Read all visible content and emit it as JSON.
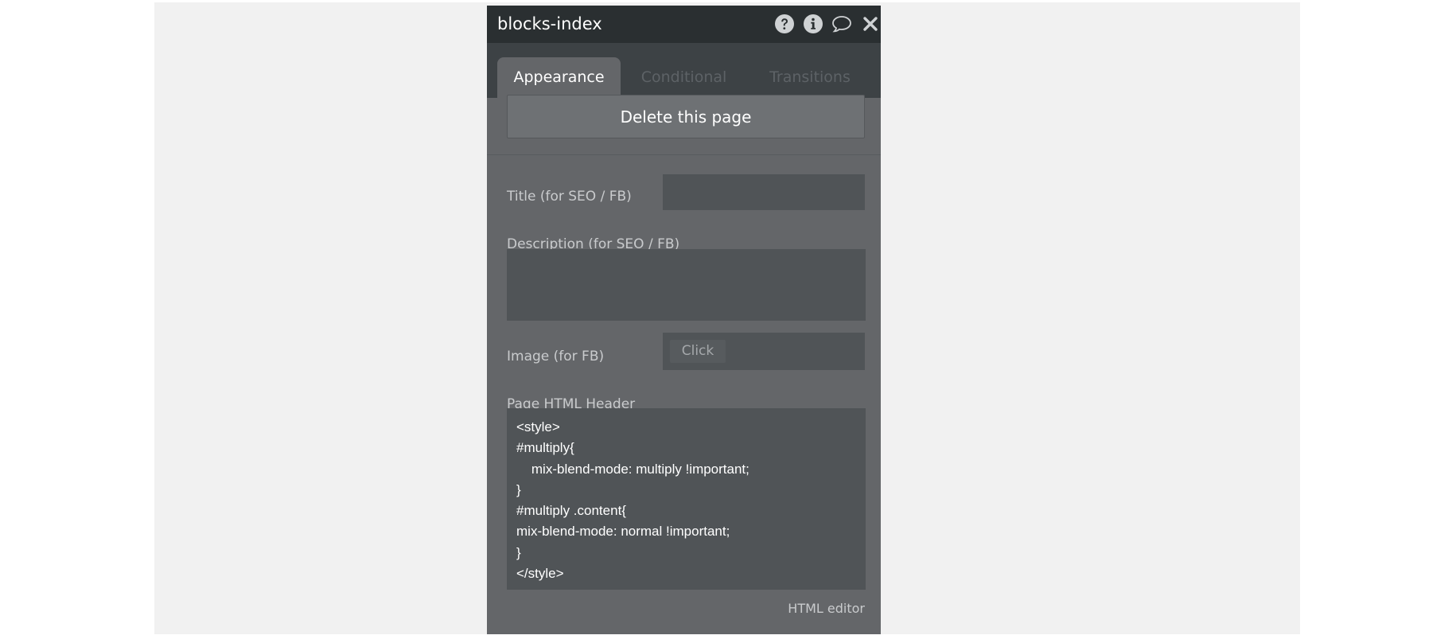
{
  "panel": {
    "title": "blocks-index"
  },
  "icons": {
    "help": "question-circle-icon",
    "info": "info-circle-icon",
    "comment": "comment-bubble-icon",
    "close": "close-icon"
  },
  "tabs": [
    {
      "label": "Appearance",
      "active": true
    },
    {
      "label": "Conditional",
      "active": false
    },
    {
      "label": "Transitions",
      "active": false
    }
  ],
  "actions": {
    "delete_label": "Delete this page"
  },
  "form": {
    "title_label": "Title (for SEO / FB)",
    "title_value": "",
    "description_label": "Description (for SEO / FB)",
    "description_value": "",
    "image_label": "Image (for FB)",
    "image_button": "Click",
    "header_label": "Page HTML Header",
    "header_code_lines": [
      "<style>",
      "#multiply{",
      "    mix-blend-mode: multiply !important;",
      "}",
      "#multiply .content{",
      "mix-blend-mode: normal !important;",
      "}",
      "</style>"
    ],
    "html_editor_link": "HTML editor"
  },
  "colors": {
    "titlebar": "#2a2f31",
    "tabbar": "#3d4245",
    "panel": "#646669",
    "field": "#505457",
    "canvas": "#f1f1f1"
  }
}
